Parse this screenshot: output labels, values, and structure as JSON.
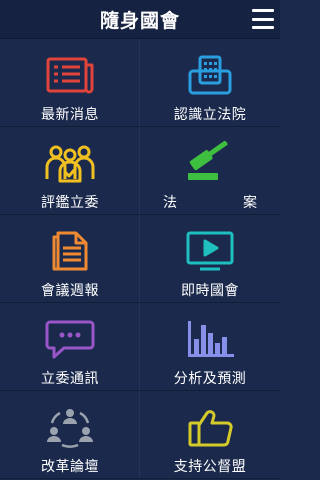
{
  "app": {
    "title": "隨身國會"
  },
  "tiles": [
    {
      "label": "最新消息",
      "icon": "newspaper-icon",
      "color": "#e0443a"
    },
    {
      "label": "認識立法院",
      "icon": "legislature-building-icon",
      "color": "#2a9fe0"
    },
    {
      "label": "評鑑立委",
      "icon": "legislator-evaluation-icon",
      "color": "#f0c020"
    },
    {
      "label": "法　案",
      "icon": "gavel-icon",
      "color": "#3fbf3f"
    },
    {
      "label": "會議週報",
      "icon": "document-icon",
      "color": "#f08a32"
    },
    {
      "label": "即時國會",
      "icon": "live-video-icon",
      "color": "#1fbfbf"
    },
    {
      "label": "立委通訊",
      "icon": "chat-bubble-icon",
      "color": "#9a55c9"
    },
    {
      "label": "分析及預測",
      "icon": "bar-chart-icon",
      "color": "#8790e8"
    },
    {
      "label": "改革論壇",
      "icon": "community-forum-icon",
      "color": "#9aa3ad"
    },
    {
      "label": "支持公督盟",
      "icon": "thumbs-up-icon",
      "color": "#d4cb2a"
    }
  ]
}
